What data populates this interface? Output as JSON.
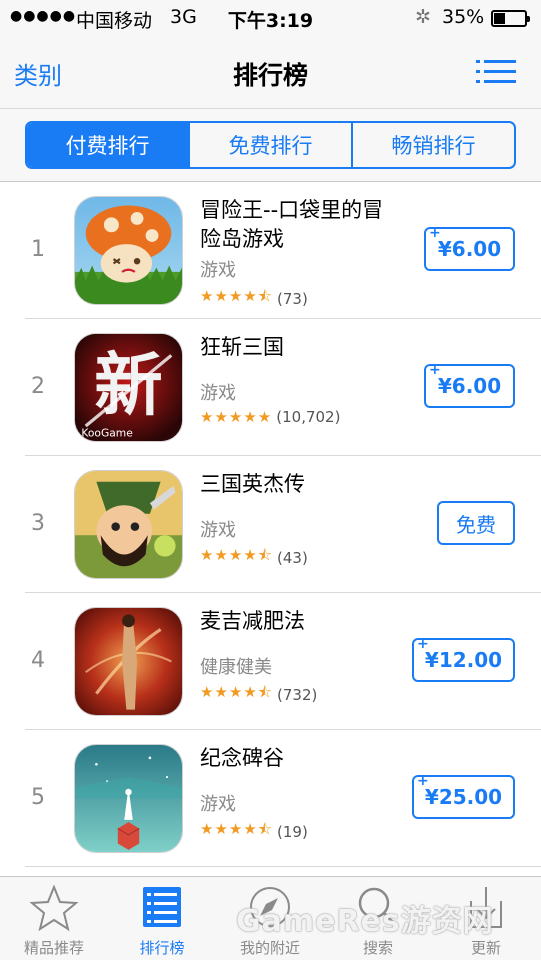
{
  "status_bar": {
    "signal": "●●●●●",
    "carrier": "中国移动",
    "network": "3G",
    "time": "下午3:19",
    "battery_pct": "35%"
  },
  "nav": {
    "back_label": "类别",
    "title": "排行榜",
    "menu_icon": "list-icon"
  },
  "segments": [
    {
      "label": "付费排行",
      "active": true
    },
    {
      "label": "免费排行",
      "active": false
    },
    {
      "label": "畅销排行",
      "active": false
    }
  ],
  "apps": [
    {
      "rank": "1",
      "name": "冒险王--口袋里的冒险岛游戏",
      "category": "游戏",
      "stars": "★★★★⯪",
      "count": "(73)",
      "price": "¥6.00",
      "plus": true,
      "icon": "mushroom-game-icon"
    },
    {
      "rank": "2",
      "name": "狂斩三国",
      "category": "游戏",
      "stars": "★★★★★",
      "count": "(10,702)",
      "price": "¥6.00",
      "plus": true,
      "icon": "kuangzhan-game-icon",
      "icon_text": "KooGame"
    },
    {
      "rank": "3",
      "name": "三国英杰传",
      "category": "游戏",
      "stars": "★★★★⯪",
      "count": "(43)",
      "price": "免费",
      "plus": false,
      "icon": "warrior-game-icon"
    },
    {
      "rank": "4",
      "name": "麦吉减肥法",
      "category": "健康健美",
      "stars": "★★★★⯪",
      "count": "(732)",
      "price": "¥12.00",
      "plus": true,
      "icon": "fitness-app-icon"
    },
    {
      "rank": "5",
      "name": "纪念碑谷",
      "category": "游戏",
      "stars": "★★★★⯪",
      "count": "(19)",
      "price": "¥25.00",
      "plus": true,
      "icon": "monument-valley-icon"
    }
  ],
  "tabs": [
    {
      "label": "精品推荐",
      "icon": "star-icon",
      "active": false
    },
    {
      "label": "排行榜",
      "icon": "ranking-list-icon",
      "active": true
    },
    {
      "label": "我的附近",
      "icon": "compass-icon",
      "active": false
    },
    {
      "label": "搜索",
      "icon": "search-icon",
      "active": false
    },
    {
      "label": "更新",
      "icon": "update-icon",
      "active": false
    }
  ],
  "watermark": "GameRes游资网",
  "colors": {
    "accent": "#1a7cf5",
    "star": "#f29b24",
    "secondary_text": "#8a8a8a"
  }
}
